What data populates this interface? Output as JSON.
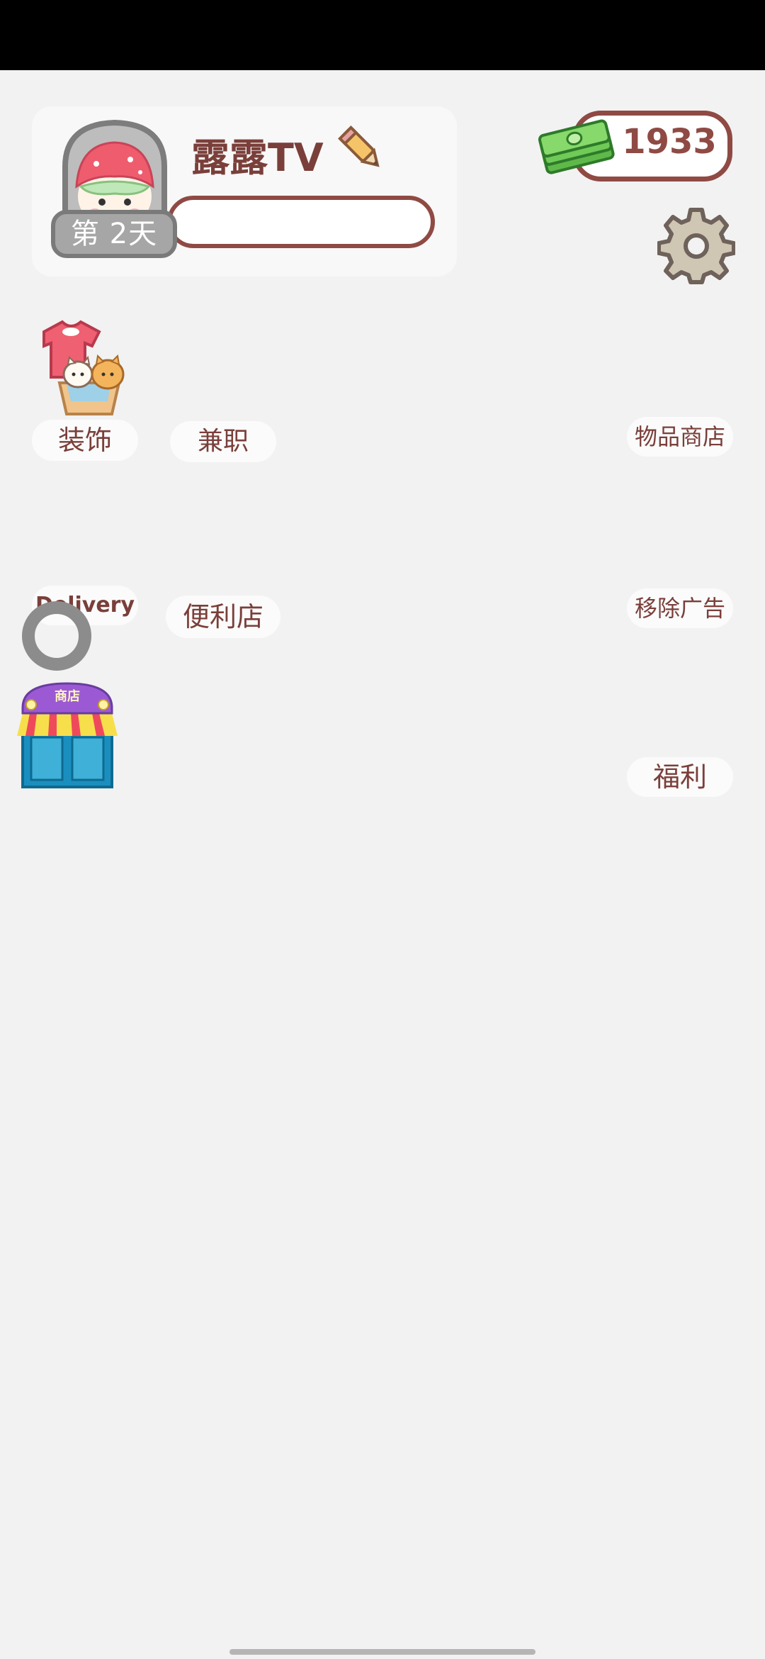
{
  "profile": {
    "player_name": "露露TV",
    "day_label": "第 2天",
    "avatar_icon": "strawberry-hat-avatar",
    "edit_icon": "pencil-icon"
  },
  "currency": {
    "money_value": "1933",
    "money_icon": "cash-stack-icon"
  },
  "settings": {
    "icon": "gear-icon"
  },
  "menu": {
    "decoration": {
      "label": "装饰",
      "icon": "clothes-cats-basket-icon"
    },
    "part_time_job": {
      "label": "兼职"
    },
    "item_shop": {
      "label": "物品商店"
    },
    "delivery": {
      "label": "Delivery",
      "icon": "loading-ring-icon"
    },
    "convenience_store": {
      "label": "便利店",
      "icon": "shop-building-icon",
      "sign": "商店"
    },
    "remove_ads": {
      "label": "移除广告"
    },
    "welfare": {
      "label": "福利"
    }
  },
  "colors": {
    "background": "#f2f2f2",
    "text_brown": "#7a3f3a",
    "border_brown": "#8f4a44"
  }
}
